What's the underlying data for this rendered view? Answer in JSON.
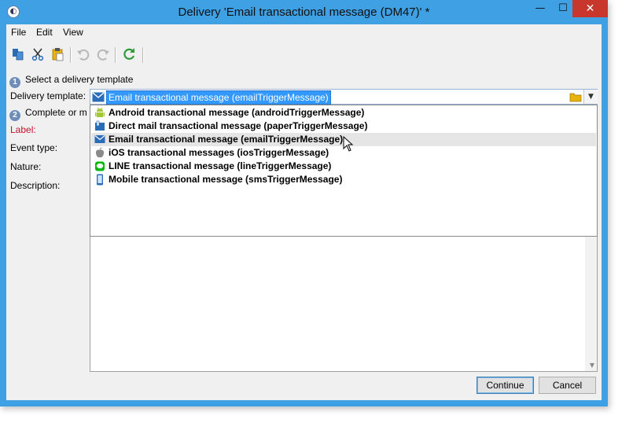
{
  "window": {
    "title": "Delivery 'Email transactional message (DM47)' *",
    "minimize_glyph": "—",
    "maximize_glyph": "☐",
    "close_glyph": "✕"
  },
  "menu": {
    "items": [
      "File",
      "Edit",
      "View"
    ]
  },
  "toolbar": {
    "icons": [
      "new-icon",
      "cut-icon",
      "paste-icon",
      "undo-icon",
      "redo-icon",
      "refresh-icon"
    ]
  },
  "step1": {
    "number": "1",
    "text": "Select a delivery template"
  },
  "step2": {
    "number": "2",
    "text": "Complete or m"
  },
  "fields": {
    "delivery_template_label": "Delivery template:",
    "label_label": "Label:",
    "event_type_label": "Event type:",
    "nature_label": "Nature:",
    "description_label": "Description:"
  },
  "combo": {
    "value": "Email transactional message (emailTriggerMessage)"
  },
  "dropdown": {
    "items": [
      {
        "label": "Android transactional message (androidTriggerMessage)",
        "icon": "android-icon"
      },
      {
        "label": "Direct mail transactional message (paperTriggerMessage)",
        "icon": "direct-mail-icon"
      },
      {
        "label": "Email transactional message (emailTriggerMessage)",
        "icon": "email-icon",
        "selected": true
      },
      {
        "label": "iOS transactional messages (iosTriggerMessage)",
        "icon": "apple-icon"
      },
      {
        "label": "LINE transactional message (lineTriggerMessage)",
        "icon": "line-icon"
      },
      {
        "label": "Mobile transactional message (smsTriggerMessage)",
        "icon": "mobile-icon"
      }
    ]
  },
  "buttons": {
    "continue": "Continue",
    "cancel": "Cancel"
  },
  "colors": {
    "accent": "#3fa0e4",
    "selection": "#3399ff",
    "required_label": "#c8102e",
    "close": "#c7372b"
  }
}
